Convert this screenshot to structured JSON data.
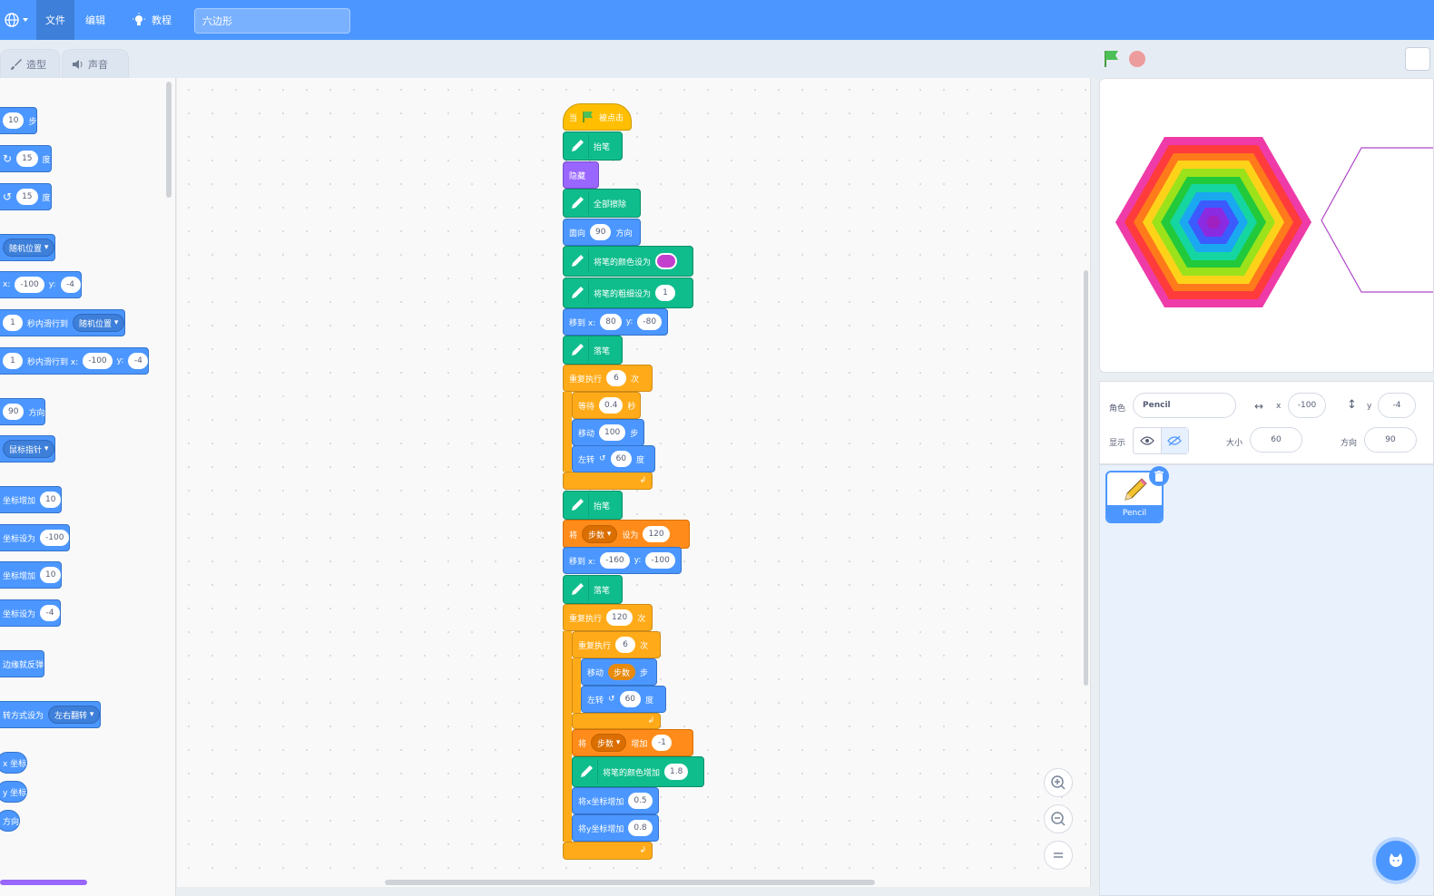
{
  "menubar": {
    "file": "文件",
    "edit": "编辑",
    "tutorials": "教程",
    "project_title": "六边形"
  },
  "tabs": {
    "costumes": "造型",
    "sounds": "声音"
  },
  "palette": {
    "move_steps": {
      "value": "10",
      "label": "步"
    },
    "turn_right": {
      "value": "15",
      "label": "度"
    },
    "turn_left": {
      "value": "15",
      "label": "度"
    },
    "goto_random": "随机位置",
    "goto_xy": {
      "x_label": "x:",
      "x": "-100",
      "y_label": "y:",
      "y": "-4"
    },
    "glide_random": {
      "secs": "1",
      "label": "秒内滑行到",
      "target": "随机位置"
    },
    "glide_xy": {
      "secs": "1",
      "label": "秒内滑行到 x:",
      "x": "-100",
      "y_label": "y:",
      "y": "-4"
    },
    "point_dir": {
      "value": "90",
      "label": "方向"
    },
    "point_towards": "鼠标指针",
    "change_x": {
      "label": "坐标增加",
      "value": "10"
    },
    "set_x": {
      "label": "坐标设为",
      "value": "-100"
    },
    "change_y": {
      "label": "坐标增加",
      "value": "10"
    },
    "set_y": {
      "label": "坐标设为",
      "value": "-4"
    },
    "bounce": "边缘就反弹",
    "rotation_style": {
      "label": "转方式设为",
      "value": "左右翻转"
    },
    "rep_x": "x 坐标",
    "rep_y": "y 坐标",
    "rep_dir": "方向"
  },
  "script": {
    "hat": {
      "when": "当",
      "clicked": "被点击"
    },
    "pen_up1": "抬笔",
    "hide": "隐藏",
    "clear": "全部擦除",
    "point_dir": {
      "label": "面向",
      "value": "90",
      "suffix": "方向"
    },
    "set_color": {
      "label": "将笔的颜色设为",
      "color": "#c53fcf"
    },
    "set_size": {
      "label": "将笔的粗细设为",
      "value": "1"
    },
    "goto1": {
      "label": "移到 x:",
      "x": "80",
      "y_label": "y:",
      "y": "-80"
    },
    "pen_down1": "落笔",
    "repeat1": {
      "label": "重复执行",
      "value": "6",
      "suffix": "次"
    },
    "wait": {
      "label": "等待",
      "value": "0.4",
      "suffix": "秒"
    },
    "move1": {
      "label": "移动",
      "value": "100",
      "suffix": "步"
    },
    "turn1": {
      "label": "左转",
      "value": "60",
      "suffix": "度"
    },
    "pen_up2": "抬笔",
    "setvar": {
      "label": "将",
      "var": "步数",
      "to": "设为",
      "value": "120"
    },
    "goto2": {
      "label": "移到 x:",
      "x": "-160",
      "y_label": "y:",
      "y": "-100"
    },
    "pen_down2": "落笔",
    "repeat2": {
      "label": "重复执行",
      "value": "120",
      "suffix": "次"
    },
    "repeat3": {
      "label": "重复执行",
      "value": "6",
      "suffix": "次"
    },
    "move2": {
      "label": "移动",
      "var": "步数",
      "suffix": "步"
    },
    "turn2": {
      "label": "左转",
      "value": "60",
      "suffix": "度"
    },
    "changevar": {
      "label": "将",
      "var": "步数",
      "by": "增加",
      "value": "-1"
    },
    "change_color": {
      "label": "将笔的颜色增加",
      "value": "1.8"
    },
    "change_x": {
      "label": "将x坐标增加",
      "value": "0.5"
    },
    "change_y": {
      "label": "将y坐标增加",
      "value": "0.8"
    }
  },
  "sprite_info": {
    "sprite_label": "角色",
    "sprite_name": "Pencil",
    "x_label": "x",
    "x": "-100",
    "y_label": "y",
    "y": "-4",
    "show_label": "显示",
    "size_label": "大小",
    "size": "60",
    "direction_label": "方向",
    "direction": "90"
  },
  "sprites": [
    {
      "name": "Pencil"
    }
  ],
  "colors": {
    "menubar": "#4c97ff",
    "motion": "#4c97ff",
    "control": "#ffab19",
    "pen": "#0fbd8c",
    "variables": "#ff8c1a",
    "looks": "#9966ff"
  }
}
